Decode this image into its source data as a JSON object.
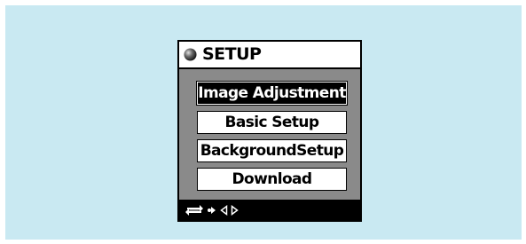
{
  "screen": {
    "title": "SETUP",
    "title_icon": "ball-icon"
  },
  "menu": {
    "items": [
      {
        "label": "Image Adjustment",
        "selected": true
      },
      {
        "label": "Basic Setup",
        "selected": false
      },
      {
        "label": "BackgroundSetup",
        "selected": false
      },
      {
        "label": "Download",
        "selected": false
      }
    ]
  },
  "footer": {
    "icons": [
      "return-icon",
      "dot-arrow-right-icon",
      "triangle-left-icon",
      "triangle-right-icon"
    ]
  },
  "colors": {
    "background": "#c9e9f2",
    "panel": "#8a8a8a",
    "bar": "#000000"
  }
}
